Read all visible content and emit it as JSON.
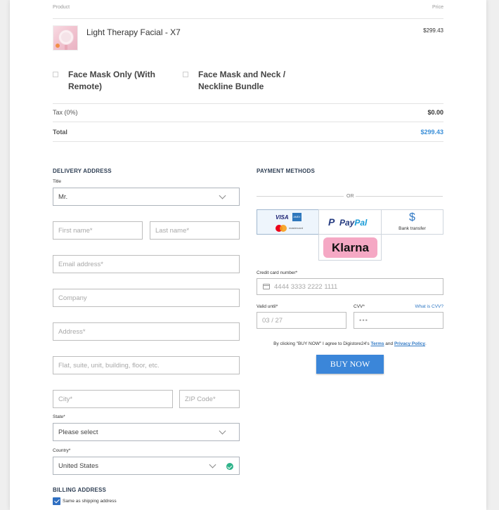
{
  "cart": {
    "product_header": "Product",
    "price_header": "Price",
    "item_name": "Light Therapy Facial - X7",
    "item_price": "$299.43",
    "options": [
      "Face Mask Only (With Remote)",
      "Face Mask and Neck / Neckline Bundle"
    ],
    "tax_label": "Tax (0%)",
    "tax_value": "$0.00",
    "total_label": "Total",
    "total_value": "$299.43"
  },
  "delivery": {
    "heading": "DELIVERY ADDRESS",
    "title_label": "Title",
    "title_value": "Mr.",
    "first_name_ph": "First name*",
    "last_name_ph": "Last name*",
    "email_ph": "Email address*",
    "company_ph": "Company",
    "address_ph": "Address*",
    "address2_ph": "Flat, suite, unit, building, floor, etc.",
    "city_ph": "City*",
    "zip_ph": "ZIP Code*",
    "state_label": "State*",
    "state_value": "Please select",
    "country_label": "Country*",
    "country_value": "United States"
  },
  "billing": {
    "heading": "BILLING ADDRESS",
    "same_label": "Same as shipping address"
  },
  "payment": {
    "heading": "PAYMENT METHODS",
    "or_label": "OR",
    "visa": "VISA",
    "amex": "AMEX",
    "mastercard": "mastercard",
    "paypal_p": "P",
    "paypal_pay": "Pay",
    "paypal_pal": "Pal",
    "bank_symbol": "$",
    "bank_label": "Bank transfer",
    "klarna": "Klarna",
    "cc_label": "Credit card number*",
    "cc_ph": "4444 3333 2222 1111",
    "valid_label": "Valid until*",
    "valid_ph": "03 / 27",
    "cvv_label": "CVV*",
    "cvv_link": "What is CVV?",
    "cvv_ph": "•••",
    "consent_prefix": "By clicking \"BUY NOW\" I agree to Digistore24's ",
    "terms": "Terms",
    "and": " and ",
    "privacy": "Privacy Policy",
    "consent_suffix": ".",
    "buy_now": "BUY NOW"
  },
  "colors": {
    "accent": "#3b86d9",
    "total": "#3b8fd8",
    "klarna": "#f5a8c4",
    "paypal_dark": "#253b80",
    "paypal_light": "#179bd7",
    "valid": "#2fb38a"
  }
}
